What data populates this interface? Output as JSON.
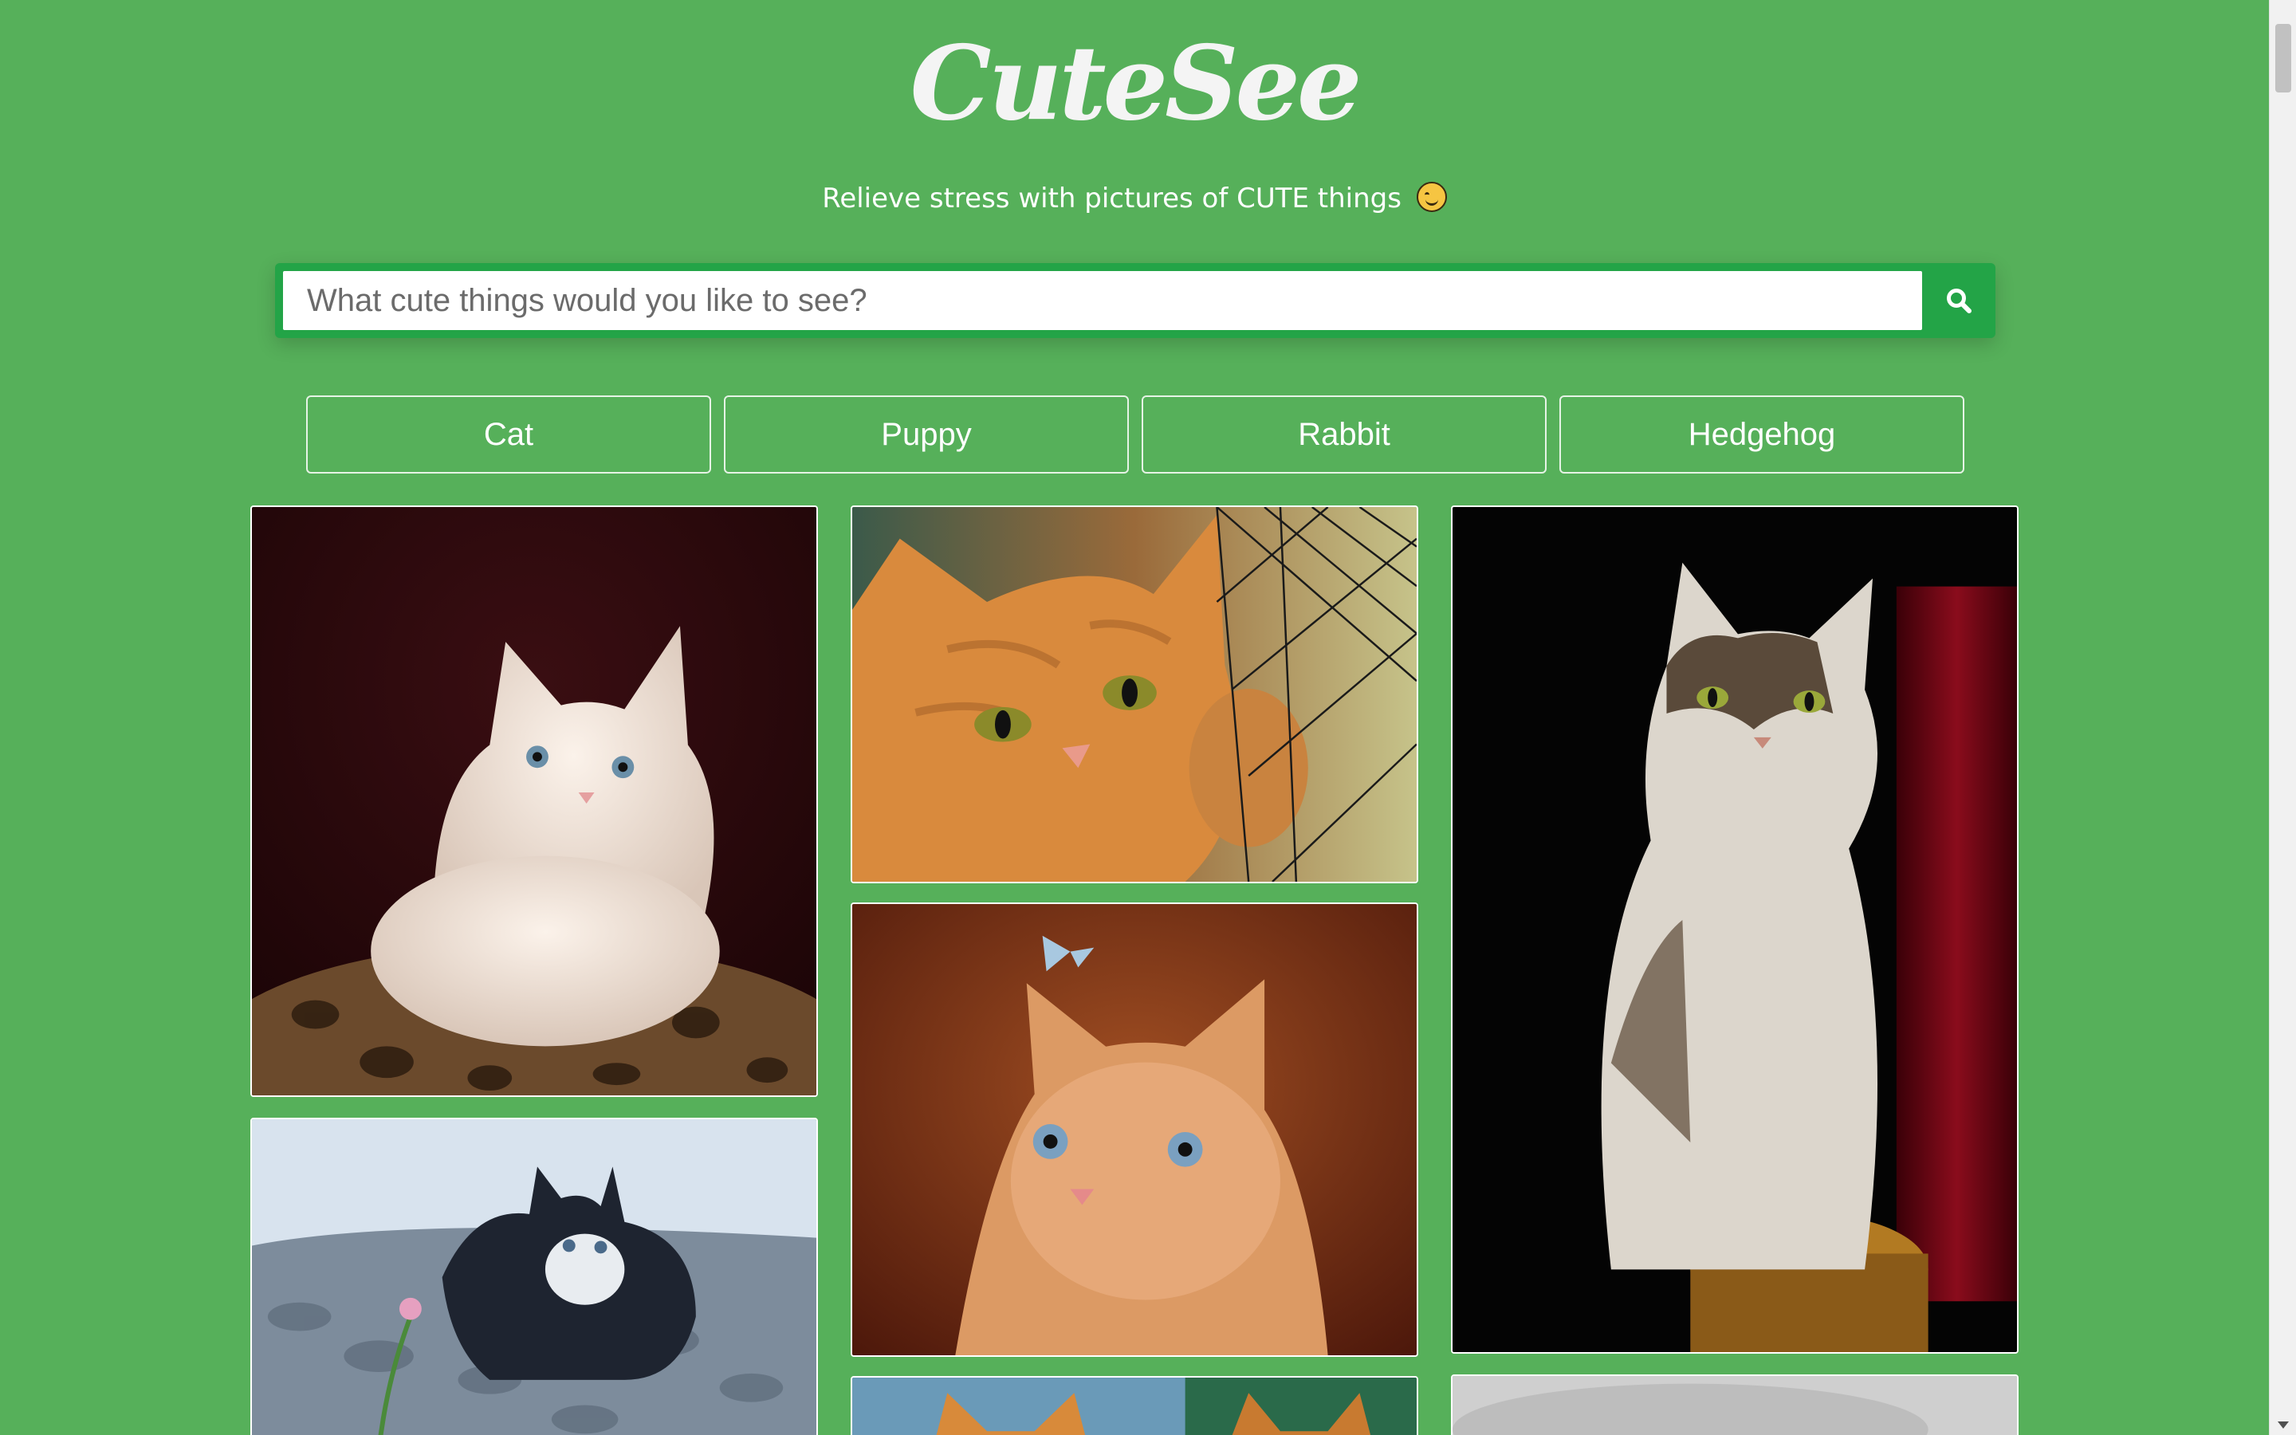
{
  "app": {
    "logo": "CuteSee",
    "tagline": "Relieve stress with pictures of CUTE things",
    "tagline_emoji": "smiling-face-icon"
  },
  "search": {
    "placeholder": "What cute things would you like to see?",
    "value": "",
    "button_icon": "search-icon"
  },
  "categories": [
    {
      "label": "Cat"
    },
    {
      "label": "Puppy"
    },
    {
      "label": "Rabbit"
    },
    {
      "label": "Hedgehog"
    }
  ],
  "gallery": {
    "photos": [
      {
        "subject": "white kitten on leopard-print bed"
      },
      {
        "subject": "ginger cat behind net"
      },
      {
        "subject": "tabby and white cat sitting"
      },
      {
        "subject": "ginger kitten looking at butterfly"
      },
      {
        "subject": "black and white kitten with flower"
      },
      {
        "subject": "ginger cats partial"
      },
      {
        "subject": "grey photo partial"
      }
    ]
  },
  "colors": {
    "background": "#56b05a",
    "search_frame": "#23a447",
    "text": "#ffffff"
  }
}
